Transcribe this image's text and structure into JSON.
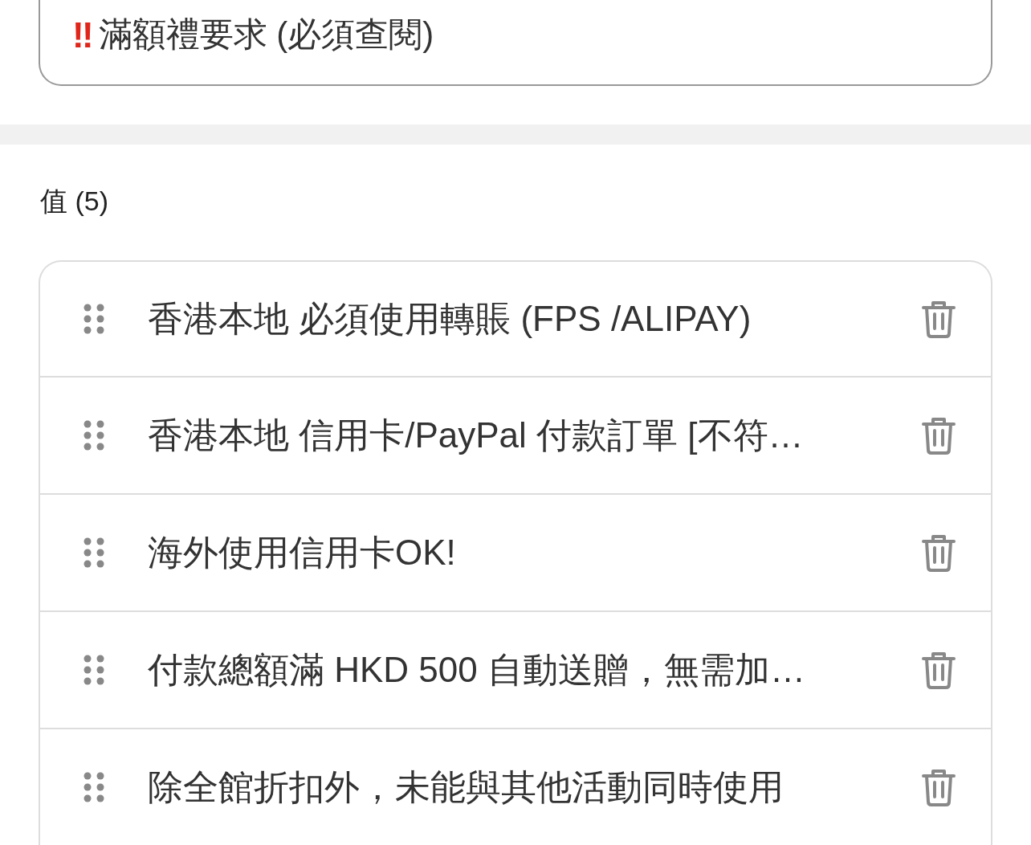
{
  "requirement_field": {
    "icon": "‼",
    "value": "滿額禮要求 (必須查閱)"
  },
  "values_section": {
    "heading": "值 (5)",
    "items": [
      {
        "text": "香港本地 必須使用轉賬 (FPS /ALIPAY)"
      },
      {
        "text": "香港本地 信用卡/PayPal 付款訂單 [不符…"
      },
      {
        "text": "海外使用信用卡OK!"
      },
      {
        "text": "付款總額滿 HKD 500 自動送贈，無需加…"
      },
      {
        "text": "除全館折扣外，未能與其他活動同時使用"
      }
    ]
  }
}
